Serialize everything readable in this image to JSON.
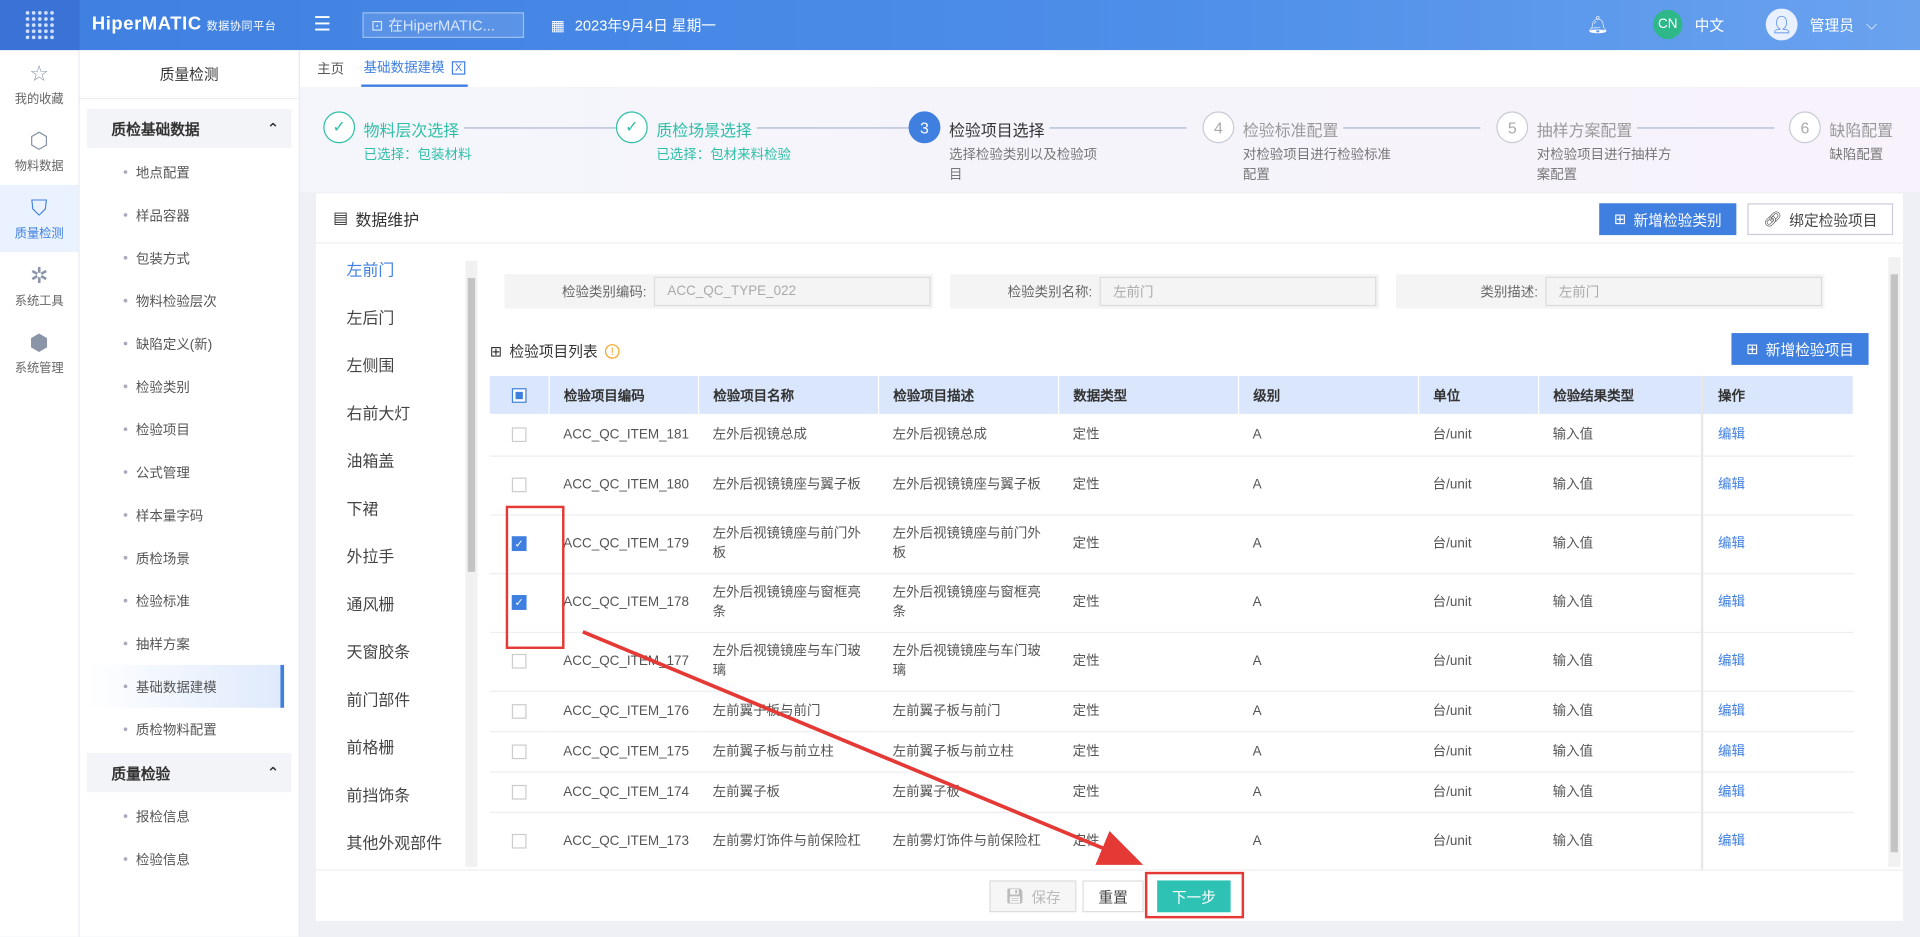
{
  "header": {
    "brand": "HiperMATIC",
    "brand_sub": "数据协同平台",
    "search_placeholder": "在HiperMATIC...",
    "date": "2023年9月4日 星期一",
    "lang_code": "CN",
    "lang_label": "中文",
    "user": "管理员"
  },
  "iconbar": [
    {
      "label": "我的收藏",
      "icon": "star-icon"
    },
    {
      "label": "物料数据",
      "icon": "cube-icon"
    },
    {
      "label": "质量检测",
      "icon": "shield-icon"
    },
    {
      "label": "系统工具",
      "icon": "network-icon"
    },
    {
      "label": "系统管理",
      "icon": "hexagon-icon"
    }
  ],
  "sidebar": {
    "title": "质量检测",
    "group1": "质检基础数据",
    "group1_items": [
      "地点配置",
      "样品容器",
      "包装方式",
      "物料检验层次",
      "缺陷定义(新)",
      "检验类别",
      "检验项目",
      "公式管理",
      "样本量字码",
      "质检场景",
      "检验标准",
      "抽样方案",
      "基础数据建模",
      "质检物料配置"
    ],
    "group2": "质量检验",
    "group2_items": [
      "报检信息",
      "检验信息"
    ]
  },
  "tabs": {
    "home": "主页",
    "current": "基础数据建模",
    "close": "X"
  },
  "steps": [
    {
      "num": "✓",
      "title": "物料层次选择",
      "desc": "已选择：包装材料"
    },
    {
      "num": "✓",
      "title": "质检场景选择",
      "desc": "已选择：包材来料检验"
    },
    {
      "num": "3",
      "title": "检验项目选择",
      "desc": "选择检验类别以及检验项目"
    },
    {
      "num": "4",
      "title": "检验标准配置",
      "desc": "对检验项目进行检验标准配置"
    },
    {
      "num": "5",
      "title": "抽样方案配置",
      "desc": "对检验项目进行抽样方案配置"
    },
    {
      "num": "6",
      "title": "缺陷配置",
      "desc": "缺陷配置"
    }
  ],
  "panel": {
    "title": "数据维护",
    "btn_add_category": "新增检验类别",
    "btn_bind": "绑定检验项目",
    "btn_add_item": "新增检验项目",
    "list_title": "检验项目列表"
  },
  "categories": [
    "左前门",
    "左后门",
    "左侧围",
    "右前大灯",
    "油箱盖",
    "下裙",
    "外拉手",
    "通风栅",
    "天窗胶条",
    "前门部件",
    "前格栅",
    "前挡饰条",
    "其他外观部件"
  ],
  "form": {
    "code_label": "检验类别编码:",
    "code_value": "ACC_QC_TYPE_022",
    "name_label": "检验类别名称:",
    "name_value": "左前门",
    "desc_label": "类别描述:",
    "desc_value": "左前门"
  },
  "table": {
    "headers": [
      "检验项目编码",
      "检验项目名称",
      "检验项目描述",
      "数据类型",
      "级别",
      "单位",
      "检验结果类型",
      "操作"
    ],
    "rows": [
      {
        "code": "ACC_QC_ITEM_181",
        "name": "左外后视镜总成",
        "desc": "左外后视镜总成",
        "type": "定性",
        "level": "A",
        "unit": "台/unit",
        "result": "输入值",
        "op": "编辑"
      },
      {
        "code": "ACC_QC_ITEM_180",
        "name": "左外后视镜镜座与翼子板",
        "desc": "左外后视镜镜座与翼子板",
        "type": "定性",
        "level": "A",
        "unit": "台/unit",
        "result": "输入值",
        "op": "编辑"
      },
      {
        "code": "ACC_QC_ITEM_179",
        "name": "左外后视镜镜座与前门外板",
        "desc": "左外后视镜镜座与前门外板",
        "type": "定性",
        "level": "A",
        "unit": "台/unit",
        "result": "输入值",
        "op": "编辑"
      },
      {
        "code": "ACC_QC_ITEM_178",
        "name": "左外后视镜镜座与窗框亮条",
        "desc": "左外后视镜镜座与窗框亮条",
        "type": "定性",
        "level": "A",
        "unit": "台/unit",
        "result": "输入值",
        "op": "编辑"
      },
      {
        "code": "ACC_QC_ITEM_177",
        "name": "左外后视镜镜座与车门玻璃",
        "desc": "左外后视镜镜座与车门玻璃",
        "type": "定性",
        "level": "A",
        "unit": "台/unit",
        "result": "输入值",
        "op": "编辑"
      },
      {
        "code": "ACC_QC_ITEM_176",
        "name": "左前翼子板与前门",
        "desc": "左前翼子板与前门",
        "type": "定性",
        "level": "A",
        "unit": "台/unit",
        "result": "输入值",
        "op": "编辑"
      },
      {
        "code": "ACC_QC_ITEM_175",
        "name": "左前翼子板与前立柱",
        "desc": "左前翼子板与前立柱",
        "type": "定性",
        "level": "A",
        "unit": "台/unit",
        "result": "输入值",
        "op": "编辑"
      },
      {
        "code": "ACC_QC_ITEM_174",
        "name": "左前翼子板",
        "desc": "左前翼子板",
        "type": "定性",
        "level": "A",
        "unit": "台/unit",
        "result": "输入值",
        "op": "编辑"
      },
      {
        "code": "ACC_QC_ITEM_173",
        "name": "左前雾灯饰件与前保险杠",
        "desc": "左前雾灯饰件与前保险杠",
        "type": "定性",
        "level": "A",
        "unit": "台/unit",
        "result": "输入值",
        "op": "编辑"
      }
    ]
  },
  "footer": {
    "save": "保存",
    "reset": "重置",
    "next": "下一步"
  },
  "colors": {
    "primary": "#3f7fe0",
    "success": "#2fbfa8",
    "next": "#2ec2b5",
    "annotation": "#e53935"
  }
}
